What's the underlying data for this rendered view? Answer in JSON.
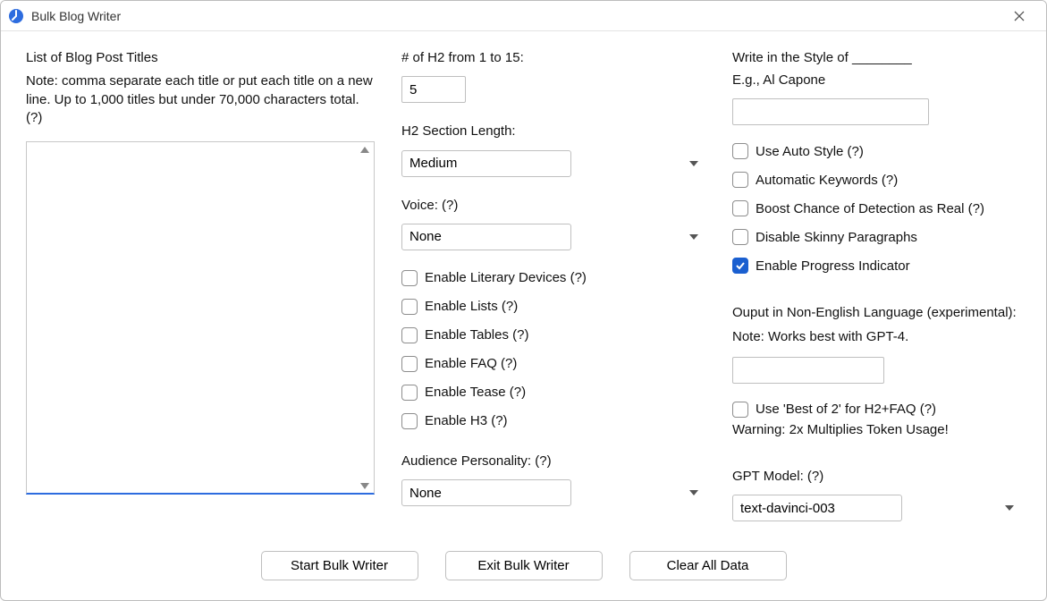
{
  "window": {
    "title": "Bulk Blog Writer"
  },
  "left": {
    "heading": "List of Blog Post Titles",
    "note": "Note: comma separate each title or put each title on a new line. Up to 1,000 titles but under 70,000 characters total.  (?)",
    "titles_value": ""
  },
  "mid": {
    "h2_count_label": "# of H2 from 1 to 15:",
    "h2_count_value": "5",
    "h2_len_label": "H2 Section Length:",
    "h2_len_value": "Medium",
    "voice_label": "Voice: (?)",
    "voice_value": "None",
    "cb_literary": "Enable Literary Devices (?)",
    "cb_lists": "Enable Lists (?)",
    "cb_tables": "Enable Tables (?)",
    "cb_faq": "Enable FAQ (?)",
    "cb_tease": "Enable Tease (?)",
    "cb_h3": "Enable H3 (?)",
    "aud_label": "Audience Personality: (?)",
    "aud_value": "None"
  },
  "right": {
    "style_label": "Write in the Style of ________",
    "style_hint": "E.g., Al Capone",
    "style_value": "",
    "cb_autostyle": "Use Auto Style (?)",
    "cb_autokw": "Automatic Keywords (?)",
    "cb_boost": "Boost Chance of Detection as Real (?)",
    "cb_skinny": "Disable Skinny Paragraphs",
    "cb_progress": "Enable Progress Indicator",
    "lang_label1": "Ouput in Non-English Language (experimental):",
    "lang_label2": "Note: Works best with GPT-4.",
    "lang_value": "",
    "cb_bestof2": "Use 'Best of 2' for H2+FAQ (?)",
    "bestof2_warn": "Warning: 2x Multiplies Token Usage!",
    "model_label": "GPT Model: (?)",
    "model_value": "text-davinci-003"
  },
  "buttons": {
    "start": "Start Bulk Writer",
    "exit": "Exit Bulk Writer",
    "clear": "Clear All Data"
  },
  "checkbox_states": {
    "cb_literary": false,
    "cb_lists": false,
    "cb_tables": false,
    "cb_faq": false,
    "cb_tease": false,
    "cb_h3": false,
    "cb_autostyle": false,
    "cb_autokw": false,
    "cb_boost": false,
    "cb_skinny": false,
    "cb_progress": true,
    "cb_bestof2": false
  }
}
